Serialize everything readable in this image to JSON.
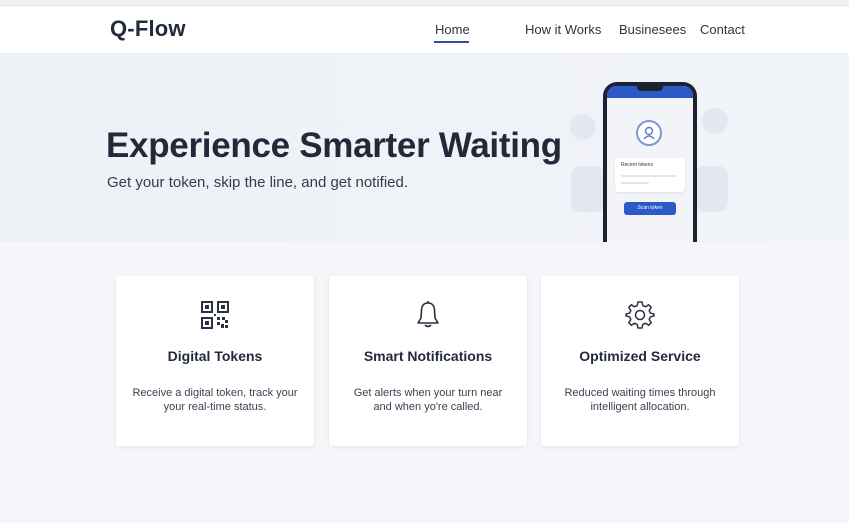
{
  "header": {
    "logo": "Q-Flow",
    "nav": [
      "Home",
      "How it Works",
      "Businesees",
      "Contact"
    ],
    "active": "Home"
  },
  "hero": {
    "title": "Experience Smarter Waiting",
    "subtitle": "Get your token, skip the line, and get notified.",
    "phone": {
      "card_label": "Recent tokens",
      "button_label": "Scan token"
    }
  },
  "features": [
    {
      "icon": "qr-code-icon",
      "title": "Digital Tokens",
      "desc": "Receive a digital token, track your your real-time status."
    },
    {
      "icon": "bell-icon",
      "title": "Smart Notifications",
      "desc": "Get alerts when your turn near and when yo're called."
    },
    {
      "icon": "gear-icon",
      "title": "Optimized Service",
      "desc": "Reduced waiting times through intelligent allocation."
    }
  ],
  "colors": {
    "accent": "#2b59c7",
    "nav_underline": "#2b4f9e",
    "text_dark": "#222a3a",
    "background": "#f4f6f9"
  }
}
